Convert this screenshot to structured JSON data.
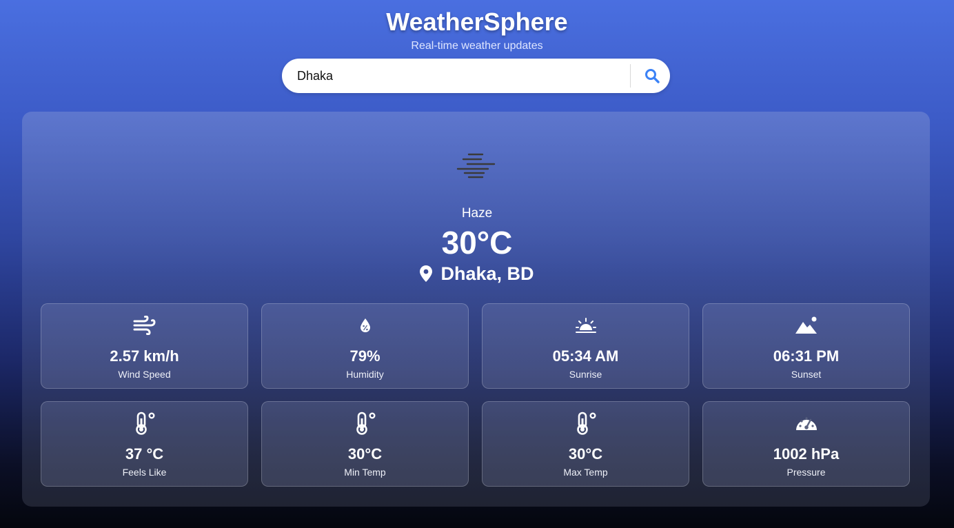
{
  "header": {
    "title": "WeatherSphere",
    "subtitle": "Real-time weather updates"
  },
  "search": {
    "value": "Dhaka",
    "button_icon": "search-icon"
  },
  "current": {
    "icon": "haze-icon",
    "condition": "Haze",
    "temperature": "30°C",
    "location_icon": "location-pin-icon",
    "location": "Dhaka, BD"
  },
  "details": [
    {
      "icon": "wind-icon",
      "value": "2.57 km/h",
      "label": "Wind Speed"
    },
    {
      "icon": "humidity-icon",
      "value": "79%",
      "label": "Humidity"
    },
    {
      "icon": "sunrise-icon",
      "value": "05:34 AM",
      "label": "Sunrise"
    },
    {
      "icon": "sunset-icon",
      "value": "06:31 PM",
      "label": "Sunset"
    },
    {
      "icon": "thermometer-icon",
      "value": "37 °C",
      "label": "Feels Like"
    },
    {
      "icon": "thermometer-icon",
      "value": "30°C",
      "label": "Min Temp"
    },
    {
      "icon": "thermometer-icon",
      "value": "30°C",
      "label": "Max Temp"
    },
    {
      "icon": "gauge-icon",
      "value": "1002 hPa",
      "label": "Pressure"
    }
  ],
  "colors": {
    "search_icon": "#3b82f6",
    "background_top": "#4a6fe0",
    "background_bottom": "#04060d"
  }
}
